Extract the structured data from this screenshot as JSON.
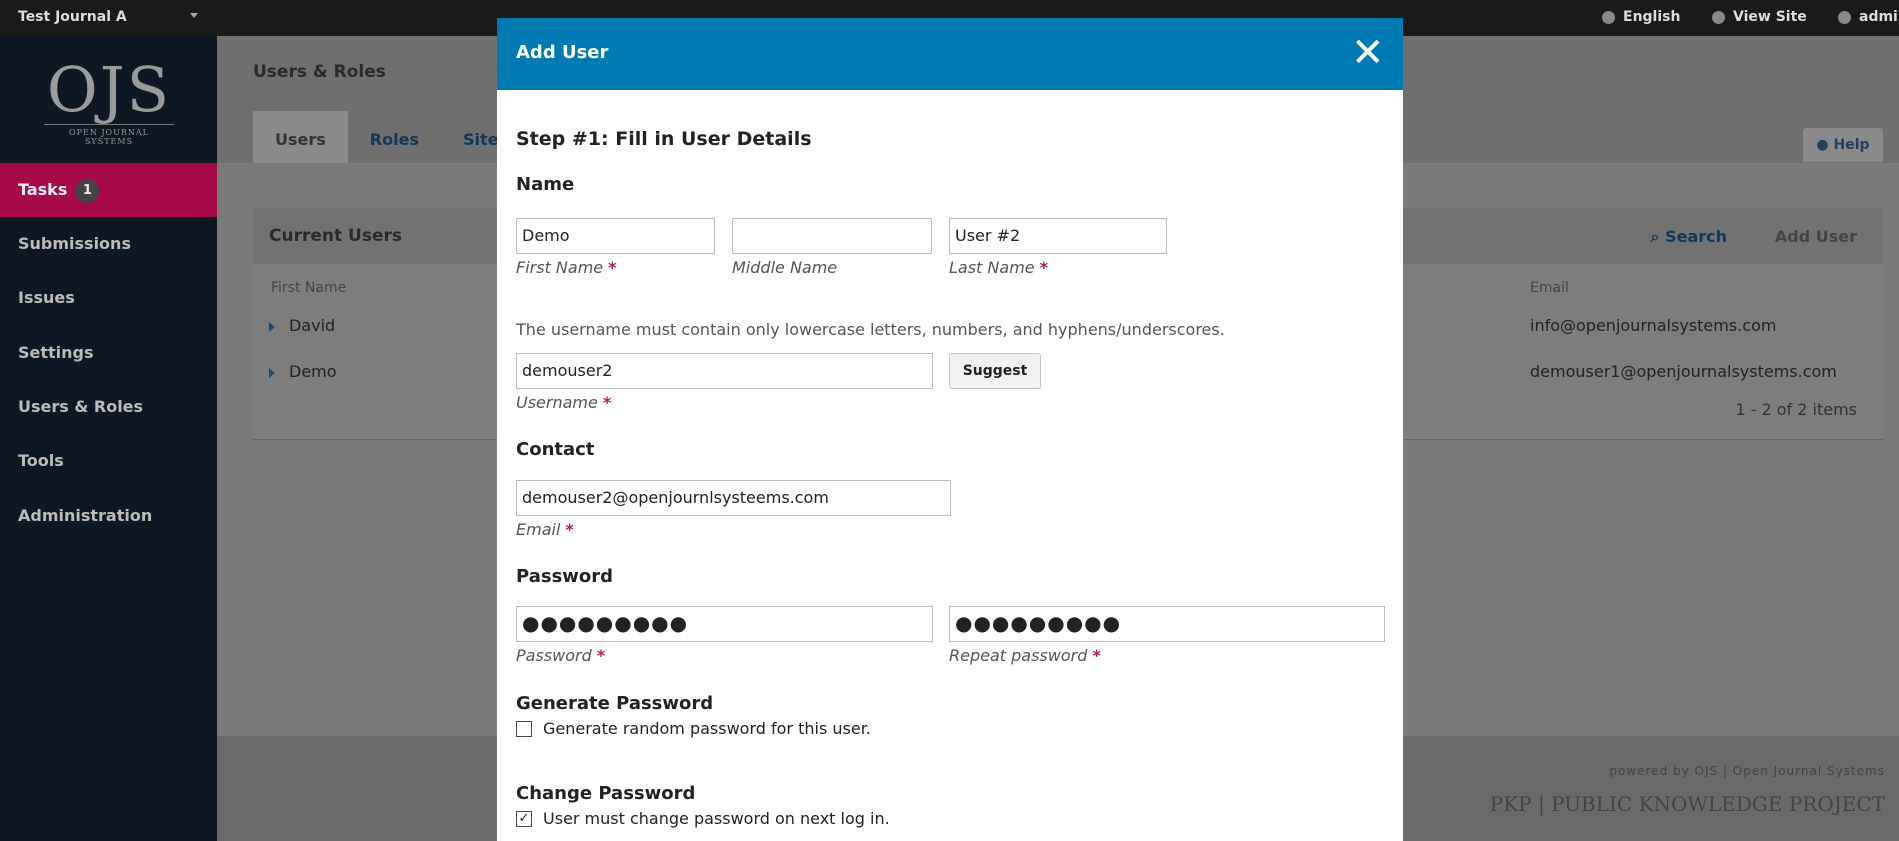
{
  "topbar": {
    "journal": "Test Journal A",
    "language": "English",
    "view_site": "View Site",
    "user": "admin"
  },
  "sidebar": {
    "logo_big": "OJS",
    "logo_small": "OPEN JOURNAL SYSTEMS",
    "items": [
      {
        "label": "Tasks",
        "badge": "1"
      },
      {
        "label": "Submissions"
      },
      {
        "label": "Issues"
      },
      {
        "label": "Settings"
      },
      {
        "label": "Users & Roles"
      },
      {
        "label": "Tools"
      },
      {
        "label": "Administration"
      }
    ]
  },
  "main": {
    "title": "Users & Roles",
    "tabs": [
      {
        "label": "Users"
      },
      {
        "label": "Roles"
      },
      {
        "label": "Site Ac"
      }
    ],
    "help": "Help",
    "panel": {
      "title": "Current Users",
      "search": "Search",
      "add_user": "Add User",
      "columns": {
        "first_name": "First Name",
        "email": "Email"
      },
      "rows": [
        {
          "first_name": "David",
          "email": "info@openjournalsystems.com"
        },
        {
          "first_name": "Demo",
          "email": "demouser1@openjournalsystems.com"
        }
      ],
      "pager": "1 - 2 of 2 items"
    },
    "footer": {
      "powered": "powered by OJS | Open Journal Systems",
      "pkp": "PKP | PUBLIC KNOWLEDGE PROJECT"
    }
  },
  "modal": {
    "title": "Add User",
    "close": "✕",
    "step": "Step #1: Fill in User Details",
    "name": {
      "section": "Name",
      "first_value": "Demo",
      "first_label": "First Name",
      "middle_value": "",
      "middle_label": "Middle Name",
      "last_value": "User #2",
      "last_label": "Last Name"
    },
    "username": {
      "note": "The username must contain only lowercase letters, numbers, and hyphens/underscores.",
      "value": "demouser2",
      "label": "Username",
      "suggest": "Suggest"
    },
    "contact": {
      "section": "Contact",
      "email_value": "demouser2@openjournlsysteems.com",
      "email_label": "Email"
    },
    "password": {
      "section": "Password",
      "value": "●●●●●●●●●",
      "label": "Password",
      "repeat_value": "●●●●●●●●●",
      "repeat_label": "Repeat password"
    },
    "generate": {
      "section": "Generate Password",
      "label": "Generate random password for this user.",
      "checked": false
    },
    "change": {
      "section": "Change Password",
      "label": "User must change password on next log in.",
      "checked": true,
      "mark": "✓"
    },
    "required_mark": "*"
  }
}
